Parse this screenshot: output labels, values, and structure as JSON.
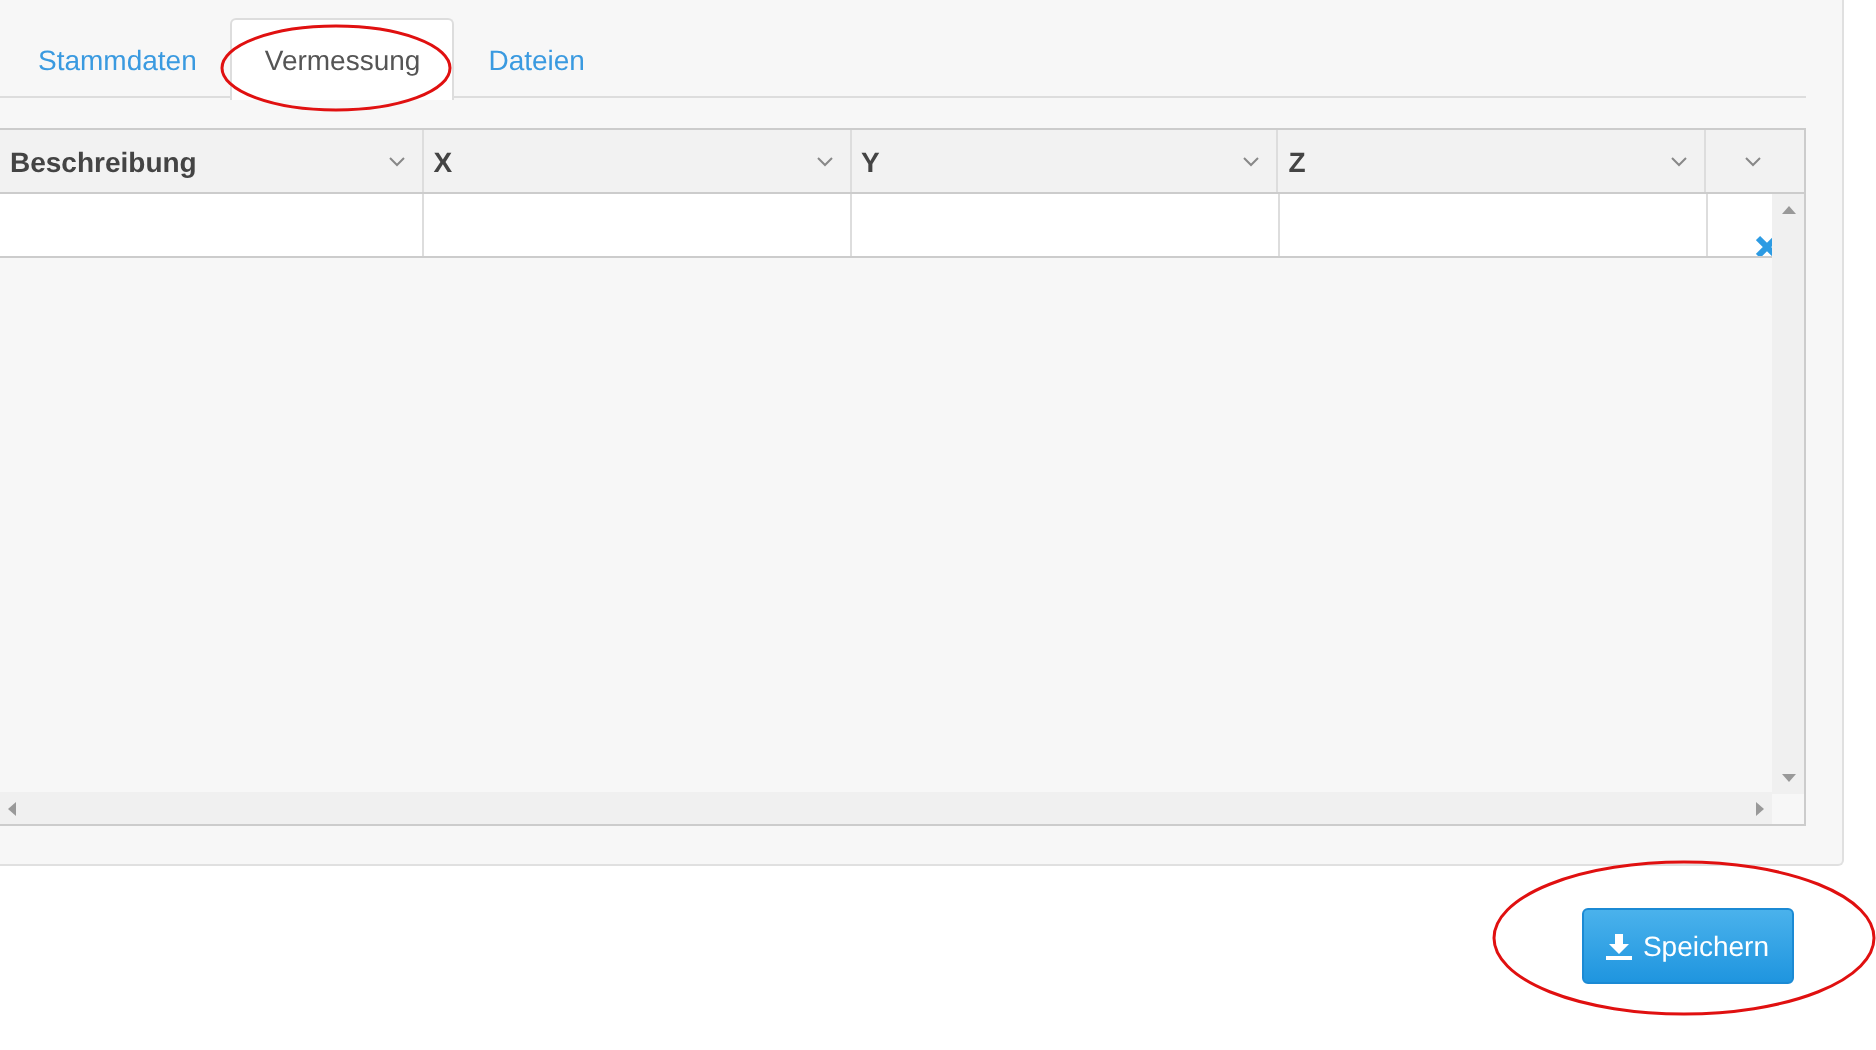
{
  "tabs": [
    {
      "label": "Stammdaten",
      "selected": false
    },
    {
      "label": "Vermessung",
      "selected": true
    },
    {
      "label": "Dateien",
      "selected": false
    }
  ],
  "table": {
    "columns": [
      "Beschreibung",
      "X",
      "Y",
      "Z"
    ],
    "rows": [
      {
        "cells": [
          "",
          "",
          "",
          ""
        ]
      }
    ]
  },
  "save_button": {
    "label": "Speichern"
  }
}
